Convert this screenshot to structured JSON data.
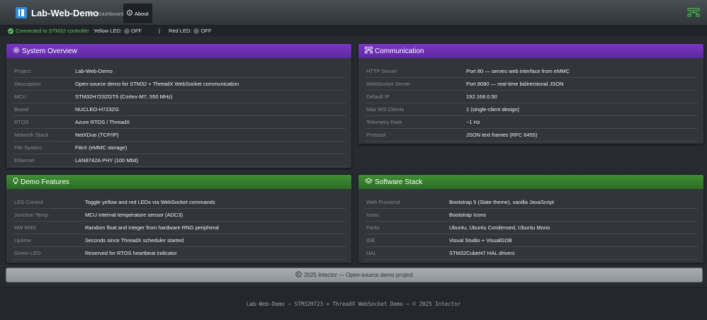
{
  "navbar": {
    "brand": "Lab-Web-Demo",
    "links": [
      {
        "label": "Dashboard",
        "icon": "speedometer-icon",
        "active": false
      },
      {
        "label": "About",
        "icon": "info-circle-icon",
        "active": true
      }
    ],
    "right_icon": "network-icon"
  },
  "status": {
    "connection": "Connected to STM32 controller",
    "yellow_label": "Yellow LED:",
    "yellow_state": "OFF",
    "separator": "|",
    "red_label": "Red LED:",
    "red_state": "OFF"
  },
  "cards": {
    "system": {
      "title": "System Overview",
      "icon": "gear-icon",
      "rows": [
        {
          "key": "Project",
          "value": "Lab-Web-Demo"
        },
        {
          "key": "Description",
          "value": "Open-source demo for STM32 + ThreadX WebSocket communication"
        },
        {
          "key": "MCU",
          "value": "STM32H723ZGT6 (Cortex-M7, 550 MHz)"
        },
        {
          "key": "Board",
          "value": "NUCLEO-H723ZG"
        },
        {
          "key": "RTOS",
          "value": "Azure RTOS / ThreadX"
        },
        {
          "key": "Network Stack",
          "value": "NetXDuo (TCP/IP)"
        },
        {
          "key": "File System",
          "value": "FileX (eMMC storage)"
        },
        {
          "key": "Ethernet",
          "value": "LAN8742A PHY (100 Mbit)"
        }
      ]
    },
    "communication": {
      "title": "Communication",
      "icon": "ethernet-icon",
      "rows": [
        {
          "key": "HTTP Server",
          "value": "Port 80 — serves web interface from eMMC"
        },
        {
          "key": "WebSocket Server",
          "value": "Port 8080 — real-time bidirectional JSON"
        },
        {
          "key": "Default IP",
          "value": "192.168.0.50"
        },
        {
          "key": "Max WS Clients",
          "value": "1 (single-client design)"
        },
        {
          "key": "Telemetry Rate",
          "value": "~1 Hz"
        },
        {
          "key": "Protocol",
          "value": "JSON text frames (RFC 6455)"
        }
      ]
    },
    "features": {
      "title": "Demo Features",
      "icon": "lightbulb-icon",
      "rows": [
        {
          "key": "LED Control",
          "value": "Toggle yellow and red LEDs via WebSocket commands"
        },
        {
          "key": "Junction Temp",
          "value": "MCU internal temperature sensor (ADC3)"
        },
        {
          "key": "HW RNG",
          "value": "Random float and integer from hardware RNG peripheral"
        },
        {
          "key": "Uptime",
          "value": "Seconds since ThreadX scheduler started"
        },
        {
          "key": "Green LED",
          "value": "Reserved for RTOS heartbeat indicator"
        }
      ]
    },
    "stack": {
      "title": "Software Stack",
      "icon": "layers-icon",
      "rows": [
        {
          "key": "Web Frontend",
          "value": "Bootstrap 5 (Slate theme), vanilla JavaScript"
        },
        {
          "key": "Icons",
          "value": "Bootstrap Icons"
        },
        {
          "key": "Fonts",
          "value": "Ubuntu, Ubuntu Condensed, Ubuntu Mono"
        },
        {
          "key": "IDE",
          "value": "Visual Studio + VisualGDB"
        },
        {
          "key": "HAL",
          "value": "STM32CubeH7 HAL drivers"
        }
      ]
    }
  },
  "copyright": "2025 Intector — Open-source demo project",
  "footer": "Lab-Web-Demo — STM32H723 + ThreadX WebSocket Demo — © 2025 Intector",
  "colors": {
    "background": "#272b30",
    "purple_header": "#6a2fb4",
    "green_header": "#357d2c",
    "connected": "#62c462"
  }
}
